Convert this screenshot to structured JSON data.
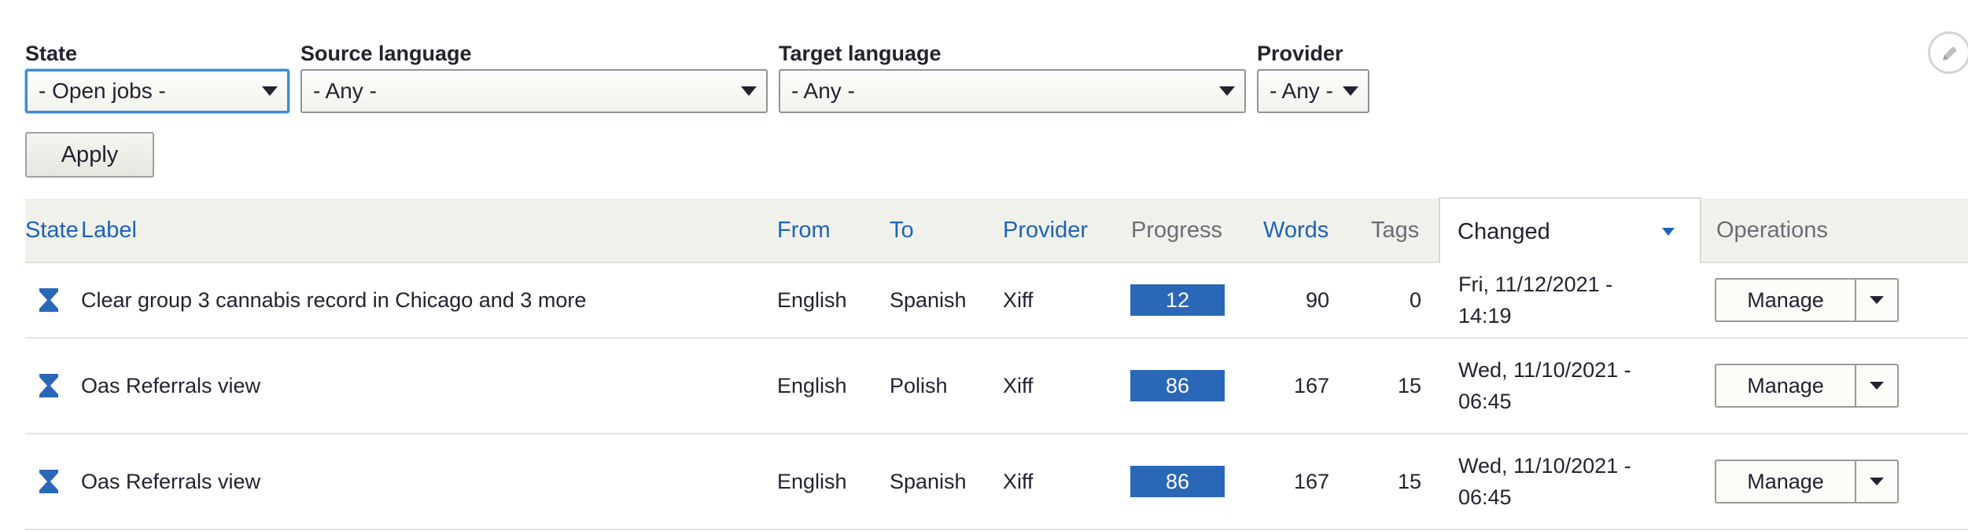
{
  "filters": {
    "state": {
      "label": "State",
      "value": "- Open jobs -"
    },
    "source_language": {
      "label": "Source language",
      "value": "- Any -"
    },
    "target_language": {
      "label": "Target language",
      "value": "- Any -"
    },
    "provider": {
      "label": "Provider",
      "value": "- Any -"
    },
    "apply_label": "Apply"
  },
  "table": {
    "headers": {
      "state": "State",
      "label": "Label",
      "from": "From",
      "to": "To",
      "provider": "Provider",
      "progress": "Progress",
      "words": "Words",
      "tags": "Tags",
      "changed": "Changed",
      "operations": "Operations"
    },
    "rows": [
      {
        "state_icon": "hourglass-icon",
        "label": "Clear group 3 cannabis record in Chicago and 3 more",
        "from": "English",
        "to": "Spanish",
        "provider": "Xiff",
        "progress": "12",
        "words": "90",
        "tags": "0",
        "changed": "Fri, 11/12/2021 - 14:19",
        "operation": "Manage"
      },
      {
        "state_icon": "hourglass-icon",
        "label": "Oas Referrals view",
        "from": "English",
        "to": "Polish",
        "provider": "Xiff",
        "progress": "86",
        "words": "167",
        "tags": "15",
        "changed": "Wed, 11/10/2021 - 06:45",
        "operation": "Manage"
      },
      {
        "state_icon": "hourglass-icon",
        "label": "Oas Referrals view",
        "from": "English",
        "to": "Spanish",
        "provider": "Xiff",
        "progress": "86",
        "words": "167",
        "tags": "15",
        "changed": "Wed, 11/10/2021 - 06:45",
        "operation": "Manage"
      }
    ]
  },
  "colors": {
    "link": "#1e62b8",
    "progress": "#2b67b7",
    "focus": "#3f8bd3"
  }
}
